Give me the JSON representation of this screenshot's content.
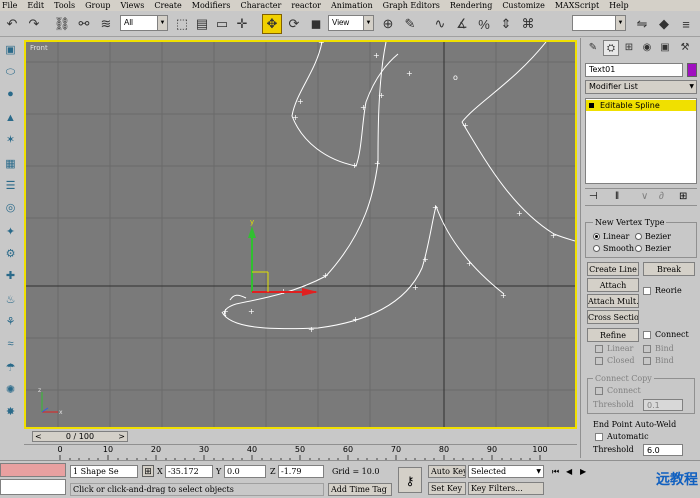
{
  "menu": [
    "File",
    "Edit",
    "Tools",
    "Group",
    "Views",
    "Create",
    "Modifiers",
    "Character",
    "reactor",
    "Animation",
    "Graph Editors",
    "Rendering",
    "Customize",
    "MAXScript",
    "Help"
  ],
  "toolbar": {
    "selection_filter": "All",
    "coord_system": "View",
    "named_selection": ""
  },
  "viewport": {
    "label": "Front",
    "axis_y": "y",
    "axis_x": "x",
    "axis_z": "z"
  },
  "command_panel": {
    "object_name": "Text01",
    "object_color": "#a010c0",
    "modifier_list": "Modifier List",
    "stack_item": "Editable Spline",
    "new_vertex_type": {
      "title": "New Vertex Type",
      "linear": "Linear",
      "bezier": "Bezier",
      "smooth": "Smooth",
      "bezier_corner": "Bezier"
    },
    "create_line": "Create Line",
    "break": "Break",
    "attach": "Attach",
    "attach_mult": "Attach Mult.",
    "reorient": "Reorie",
    "cross_section": "Cross Section",
    "refine": "Refine",
    "connect": "Connect",
    "linear": "Linear",
    "bind_first": "Bind",
    "closed": "Closed",
    "bind_last": "Bind",
    "connect_copy": "Connect Copy",
    "connect_copy_connect": "Connect",
    "threshold_label": "Threshold",
    "threshold_value": "0.1",
    "end_point_weld": "End Point Auto-Weld",
    "automatic": "Automatic",
    "threshold2_label": "Threshold",
    "threshold2_value": "6.0"
  },
  "timeline": {
    "frame_display": "0 / 100",
    "ticks": [
      "0",
      "10",
      "20",
      "30",
      "40",
      "50",
      "60",
      "70",
      "80",
      "90",
      "100"
    ]
  },
  "status": {
    "selection_count": "1 Shape Se",
    "x_label": "X",
    "x_value": "-35.172",
    "y_label": "Y",
    "y_value": "0.0",
    "z_label": "Z",
    "z_value": "-1.79",
    "grid": "Grid = 10.0",
    "auto_key": "Auto Key",
    "selected": "Selected",
    "set_key": "Set Key",
    "key_filters": "Key Filters...",
    "prompt": "Click or click-and-drag to select objects",
    "add_time_tag": "Add Time Tag"
  },
  "watermark": "远教程"
}
